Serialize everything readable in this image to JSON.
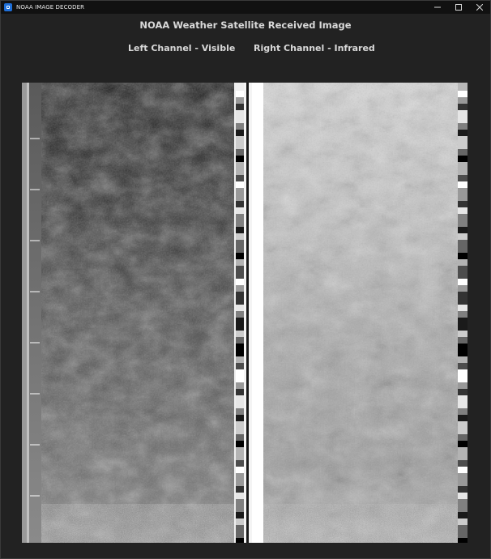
{
  "window": {
    "title": "NOAA IMAGE DECODER",
    "controls": {
      "minimize": "minimize-icon",
      "maximize": "maximize-icon",
      "close": "close-icon"
    }
  },
  "main": {
    "heading": "NOAA Weather Satellite Received Image",
    "left_channel_label": "Left Channel - Visible",
    "right_channel_label": "Right Channel - Infrared"
  },
  "colors": {
    "window_bg": "#222222",
    "titlebar_bg": "#111111",
    "text": "#d9d9d9",
    "app_icon": "#1e6fd9"
  }
}
